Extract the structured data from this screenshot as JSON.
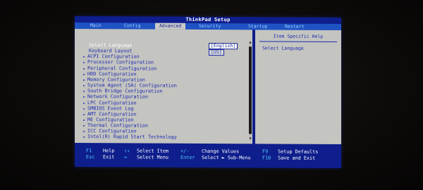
{
  "window": {
    "title": "ThinkPad Setup"
  },
  "tabs": [
    {
      "label": "Main",
      "active": false
    },
    {
      "label": "Config",
      "active": false
    },
    {
      "label": "Advanced",
      "active": true
    },
    {
      "label": "Security",
      "active": false
    },
    {
      "label": "Startup",
      "active": false
    },
    {
      "label": "Restart",
      "active": false
    }
  ],
  "menu": {
    "items": [
      {
        "label": "Select Language",
        "arrow": false,
        "selected": true
      },
      {
        "label": "Keyboard Layout",
        "arrow": false,
        "selected": false
      },
      {
        "label": "ACPI Configuration",
        "arrow": true
      },
      {
        "label": "Processor Configuration",
        "arrow": true
      },
      {
        "label": "Peripheral Configuration",
        "arrow": true
      },
      {
        "label": "HDD Configuration",
        "arrow": true
      },
      {
        "label": "Memory Configuration",
        "arrow": true
      },
      {
        "label": "System Agent (SA) Configuration",
        "arrow": true
      },
      {
        "label": "South Bridge Configuration",
        "arrow": true
      },
      {
        "label": "Network Configuration",
        "arrow": true
      },
      {
        "label": "LPC Configuration",
        "arrow": true
      },
      {
        "label": "SMBIOS Event Log",
        "arrow": true
      },
      {
        "label": "AMT Configuration",
        "arrow": true
      },
      {
        "label": "ME Configuration",
        "arrow": true
      },
      {
        "label": "Thermal Configuration",
        "arrow": true
      },
      {
        "label": "ICC Configuration",
        "arrow": true
      },
      {
        "label": "Intel(R) Rapid Start Technology",
        "arrow": true
      }
    ],
    "arrow_glyph": "►",
    "values": {
      "language": "[English]",
      "keyboard": "[US]"
    }
  },
  "help": {
    "title": "Item Specific Help",
    "text": "Select Language"
  },
  "footer": {
    "row1": [
      {
        "key": "F1",
        "desc": "Help"
      },
      {
        "key": "↑↓",
        "desc": "Select Item"
      },
      {
        "key": "+/-",
        "desc": "Change Values"
      },
      {
        "key": "F9",
        "desc": "Setup Defaults"
      }
    ],
    "row2": [
      {
        "key": "Esc",
        "desc": "Exit"
      },
      {
        "key": "↔",
        "desc": "Select Menu"
      },
      {
        "key": "Enter",
        "desc": "Select ► Sub-Menu"
      },
      {
        "key": "F10",
        "desc": "Save and Exit"
      }
    ]
  },
  "colors": {
    "bios_blue": "#0e1e8c",
    "tab_bar": "#1f53c4",
    "panel_grey": "#c4c4c0",
    "text_blue": "#1c2bb0",
    "key_cyan": "#4fd0ff"
  }
}
